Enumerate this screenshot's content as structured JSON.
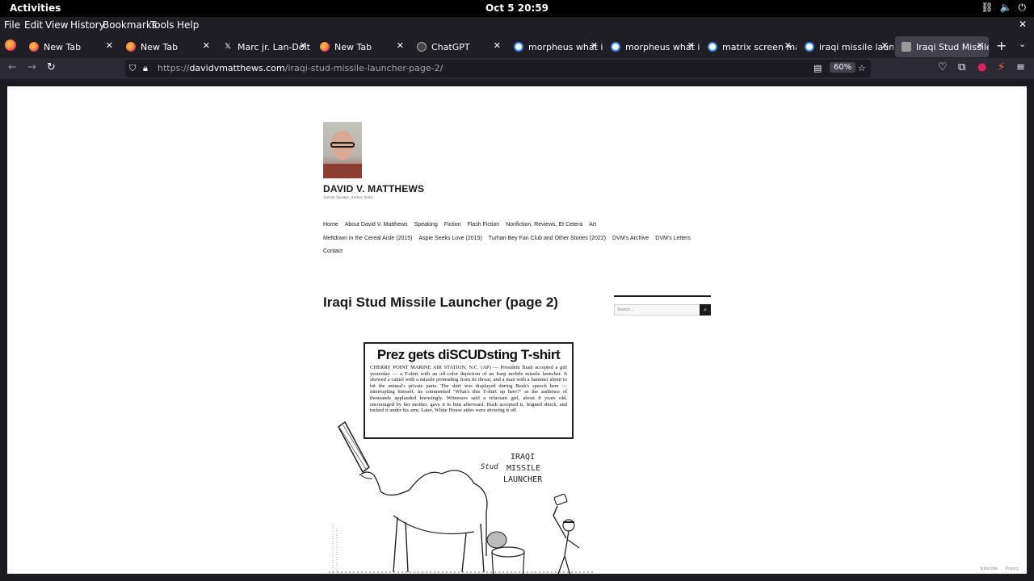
{
  "system_bar": {
    "activities": "Activities",
    "clock": "Oct 5  20:59"
  },
  "menu": [
    "File",
    "Edit",
    "View",
    "History",
    "Bookmarks",
    "Tools",
    "Help"
  ],
  "tabs": [
    {
      "title": "New Tab",
      "favicon": "firefox-icon"
    },
    {
      "title": "New Tab",
      "favicon": "firefox-icon"
    },
    {
      "title": "Marc jr. Lan-Dolt (@",
      "favicon": "x-icon"
    },
    {
      "title": "New Tab",
      "favicon": "firefox-icon"
    },
    {
      "title": "ChatGPT",
      "favicon": "chatgpt-icon"
    },
    {
      "title": "morpheus what is rea",
      "favicon": "google-icon"
    },
    {
      "title": "morpheus what is rea",
      "favicon": "google-icon"
    },
    {
      "title": "matrix screen matri",
      "favicon": "google-icon"
    },
    {
      "title": "iraqi missile launch",
      "favicon": "google-icon"
    },
    {
      "title": "Iraqi Stud Missile La",
      "favicon": "site-icon",
      "active": true
    }
  ],
  "urlbar": {
    "prefix": "https://",
    "domain": "davidvmatthews.com",
    "path": "/iraqi-stud-missile-launcher-page-2/",
    "zoom": "60%"
  },
  "site": {
    "title": "DAVID V. MATTHEWS",
    "description": "Autism Speaker, Author, Artist",
    "nav_row1": [
      "Home",
      "About David V. Matthews",
      "Speaking",
      "Fiction",
      "Flash Fiction",
      "Nonfiction, Reviews, Et Cetera",
      "Art"
    ],
    "nav_row2": [
      "Meltdown in the Cereal Aisle (2015)",
      "Aspie Seeks Love (2015)",
      "Turhan Bey Fan Club and Other Stories (2022)",
      "DVM's Archive",
      "DVM's Letters"
    ],
    "nav_row3": [
      "Contact"
    ],
    "post_title": "Iraqi Stud Missile Launcher (page 2)",
    "search_placeholder": "Search ...",
    "footer": [
      "Subscribe",
      "Privacy"
    ]
  },
  "clipping": {
    "headline": "Prez gets diSCUDsting T-shirt",
    "body": "CHERRY POINT MARINE AIR STATION, N.C. (AP) — President Bush accepted a gift yesterday — a T-shirt with an off-color depiction of an Iraqi mobile missile launcher. It showed a camel with a missile protruding from its throat, and a man with a hammer about to hit the animal's private parts. The shirt was displayed during Bush's speech here — interrupting himself, he commented \"What's this T-shirt up here?\" as the audience of thousands applauded knowingly. Witnesses said a reluctant girl, about 8 years old, encouraged by her mother, gave it to him afterward. Bush accepted it, feigned shock, and tucked it under his arm. Later, White House aides were showing it off.",
    "cartoon_label_1": "IRAQI",
    "cartoon_label_2": "MISSILE",
    "cartoon_label_3": "LAUNCHER",
    "cartoon_label_stud": "Stud"
  }
}
